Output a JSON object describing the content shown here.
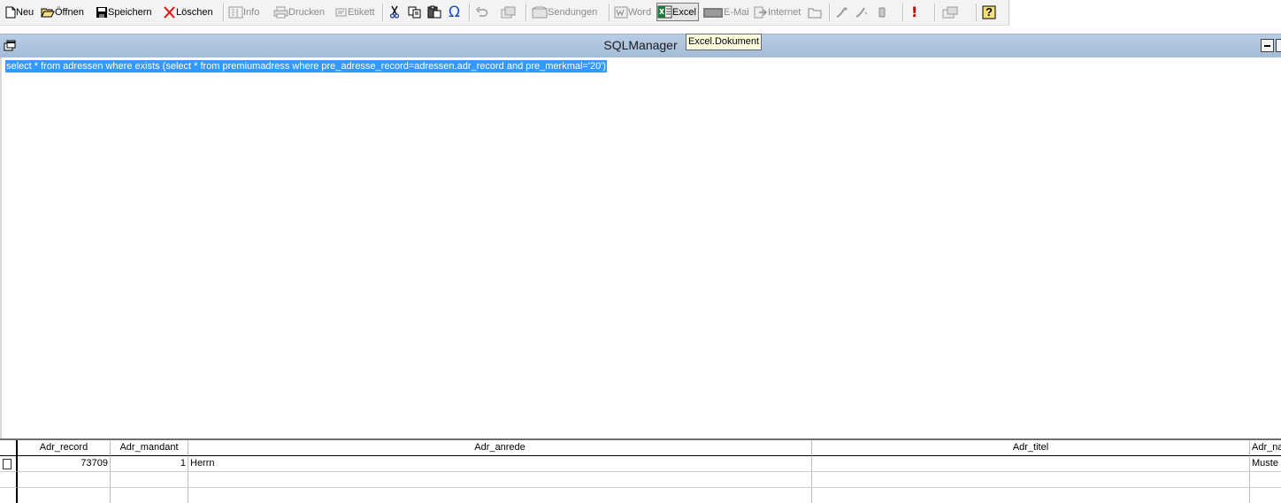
{
  "toolbar": {
    "new_label": "Neu",
    "open_label": "Öffnen",
    "save_label": "Speichern",
    "delete_label": "Löschen",
    "info_label": "Info",
    "print_label": "Drucken",
    "label_label": "Etikett",
    "omega_glyph": "Ω",
    "sendungen_label": "Sendungen",
    "word_label": "Word",
    "excel_label": "Excel",
    "email_label": "E-Mai",
    "internet_label": "Internet",
    "alert_glyph": "!",
    "help_glyph": "?"
  },
  "tooltip": {
    "text": "Excel.Dokument"
  },
  "window": {
    "title": "SQLManager"
  },
  "editor": {
    "sql": "select * from adressen where exists (select * from premiumadress where pre_adresse_record=adressen.adr_record and pre_merkmal='20')"
  },
  "grid": {
    "columns": [
      "Adr_record",
      "Adr_mandant",
      "Adr_anrede",
      "Adr_titel",
      "Adr_na"
    ],
    "rows": [
      {
        "adr_record": "73709",
        "adr_mandant": "1",
        "adr_anrede": "Herrn",
        "adr_titel": "",
        "adr_name": "Muste"
      }
    ]
  },
  "colors": {
    "title_bar": "#a4bcd9",
    "selection": "#3399ff",
    "tooltip_bg": "#ffffe1",
    "delete_red": "#e01010",
    "excel_green": "#1e7a3c"
  }
}
